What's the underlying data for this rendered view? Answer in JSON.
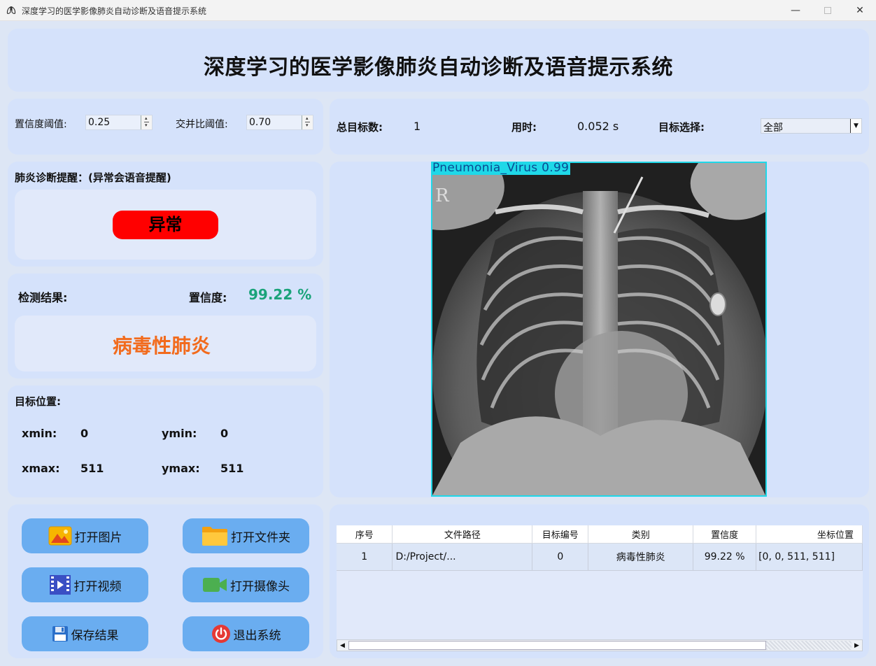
{
  "window": {
    "title": "深度学习的医学影像肺炎自动诊断及语音提示系统"
  },
  "header": {
    "title": "深度学习的医学影像肺炎自动诊断及语音提示系统"
  },
  "params": {
    "conf_label": "置信度阈值:",
    "conf_value": "0.25",
    "iou_label": "交并比阈值:",
    "iou_value": "0.70"
  },
  "stats": {
    "total_label": "总目标数:",
    "total_value": "1",
    "time_label": "用时:",
    "time_value": "0.052 s",
    "select_label": "目标选择:",
    "select_value": "全部"
  },
  "alert": {
    "title": "肺炎诊断提醒：(异常会语音提醒)",
    "status": "异常",
    "status_color": "#ff0000"
  },
  "detection": {
    "result_label": "检测结果:",
    "confidence_label": "置信度:",
    "confidence_value": "99.22 %",
    "result_value": "病毒性肺炎"
  },
  "position": {
    "title": "目标位置:",
    "xmin_label": "xmin:",
    "xmin_value": "0",
    "ymin_label": "ymin:",
    "ymin_value": "0",
    "xmax_label": "xmax:",
    "xmax_value": "511",
    "ymax_label": "ymax:",
    "ymax_value": "511"
  },
  "buttons": {
    "open_image": "打开图片",
    "open_folder": "打开文件夹",
    "open_video": "打开视频",
    "open_camera": "打开摄像头",
    "save_result": "保存结果",
    "exit": "退出系统"
  },
  "image": {
    "label": "Pneumonia_Virus  0.99",
    "marker": "R"
  },
  "table": {
    "headers": [
      "序号",
      "文件路径",
      "目标编号",
      "类别",
      "置信度",
      "坐标位置"
    ],
    "rows": [
      [
        "1",
        "D:/Project/...",
        "0",
        "病毒性肺炎",
        "99.22 %",
        "[0, 0, 511, 511]"
      ]
    ]
  },
  "colors": {
    "accent_button": "#6aadf0",
    "panel": "#d5e2fb",
    "result_orange": "#f26b1d",
    "confidence_green": "#1aa37a",
    "detection_box": "#1fd8e8"
  }
}
